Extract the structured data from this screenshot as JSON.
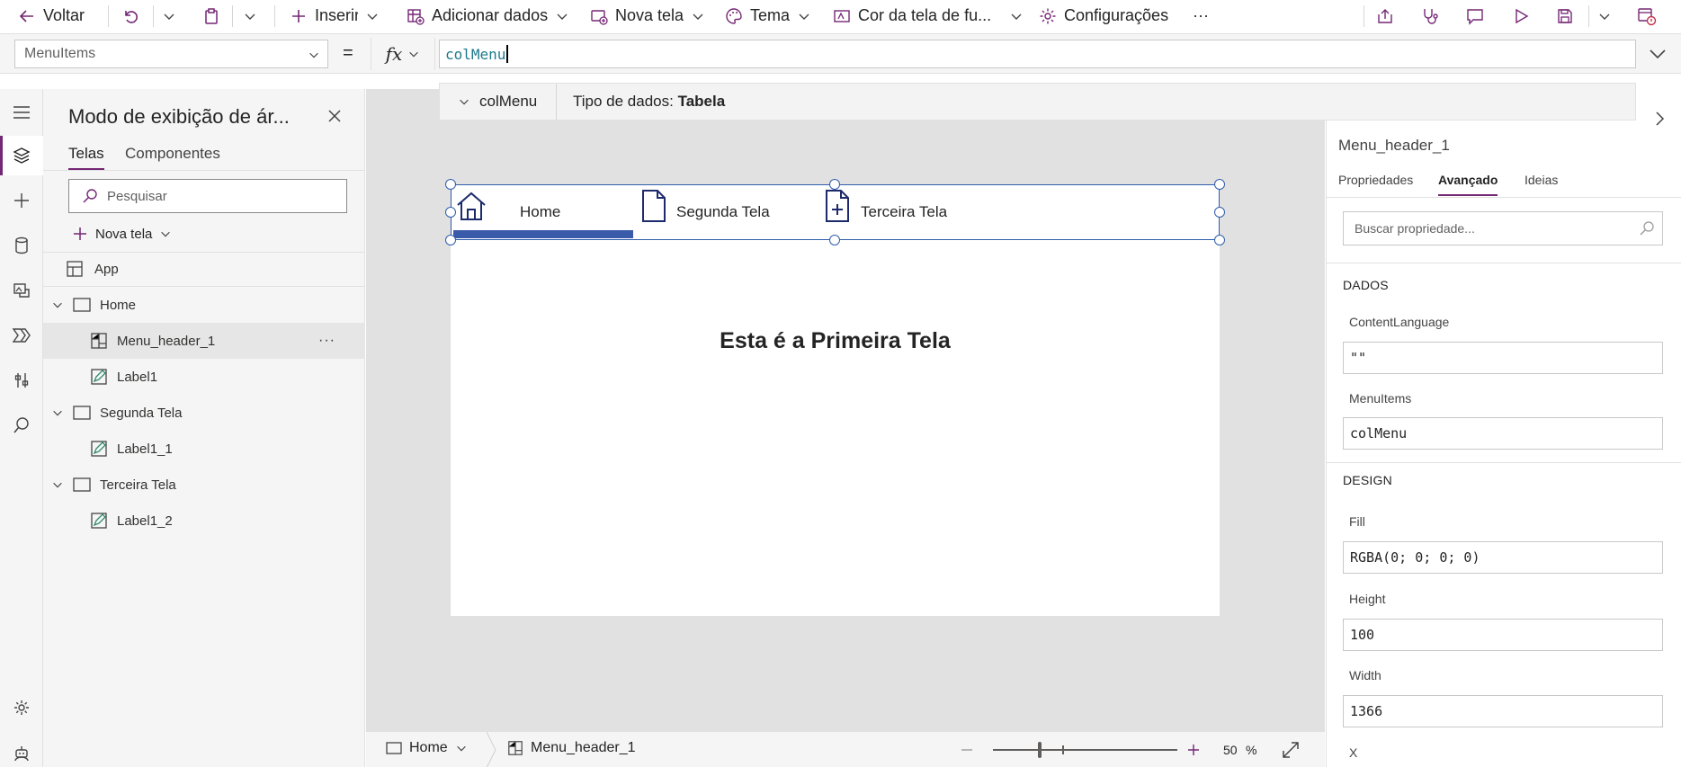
{
  "command_bar": {
    "back": "Voltar",
    "insert": "Inserir",
    "add_data": "Adicionar dados",
    "new_screen": "Nova tela",
    "theme": "Tema",
    "bg_color": "Cor da tela de fu...",
    "settings": "Configurações",
    "more": "···"
  },
  "formula_bar": {
    "property": "MenuItems",
    "equals": "=",
    "fx": "fx",
    "formula": "colMenu",
    "autocomplete_item": "colMenu",
    "datatype_label": "Tipo de dados:",
    "datatype_value": "Tabela"
  },
  "tree_view": {
    "title": "Modo de exibição de ár...",
    "tabs": [
      "Telas",
      "Componentes"
    ],
    "search_placeholder": "Pesquisar",
    "new_screen": "Nova tela",
    "app": "App",
    "items": [
      {
        "label": "Home"
      },
      {
        "label": "Menu_header_1"
      },
      {
        "label": "Label1"
      },
      {
        "label": "Segunda Tela"
      },
      {
        "label": "Label1_1"
      },
      {
        "label": "Terceira Tela"
      },
      {
        "label": "Label1_2"
      }
    ],
    "row_more": "···"
  },
  "canvas": {
    "menu": [
      "Home",
      "Segunda Tela",
      "Terceira Tela"
    ],
    "label_text": "Esta é a Primeira Tela"
  },
  "status_bar": {
    "screen": "Home",
    "control": "Menu_header_1",
    "zoom": "50",
    "zoom_unit": "%"
  },
  "properties_panel": {
    "control_name": "Menu_header_1",
    "tabs": [
      "Propriedades",
      "Avançado",
      "Ideias"
    ],
    "search_placeholder": "Buscar propriedade...",
    "data_section": "DADOS",
    "design_section": "DESIGN",
    "props": {
      "content_language": {
        "label": "ContentLanguage",
        "value": "\"\""
      },
      "menu_items": {
        "label": "MenuItems",
        "value": "colMenu"
      },
      "fill": {
        "label": "Fill",
        "value": "RGBA(0; 0; 0; 0)"
      },
      "height": {
        "label": "Height",
        "value": "100"
      },
      "width": {
        "label": "Width",
        "value": "1366"
      },
      "x": {
        "label": "X"
      }
    }
  },
  "colors": {
    "accent": "#742774",
    "selection": "#2f5dab",
    "menu_icon": "#1d2a6b",
    "menu_underline": "#3a5ba9"
  }
}
